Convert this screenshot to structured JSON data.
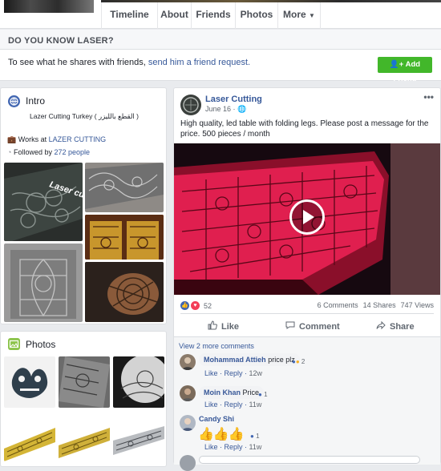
{
  "tabs": [
    "Timeline",
    "About",
    "Friends",
    "Photos",
    "More"
  ],
  "dykl": {
    "heading": "DO YOU KNOW LASER?",
    "text_prefix": "To see what he shares with friends,",
    "link": "send him a friend request.",
    "button": "Add Friend"
  },
  "intro": {
    "title": "Intro",
    "bio": "Lazer Cutting Turkey ( القطع بالليزر )",
    "works_prefix": "Works at",
    "works_at": "LAZER CUTTING",
    "followed_prefix": "Followed by",
    "followed_count": "272 people",
    "thumb_caption": "Laser cu"
  },
  "photos": {
    "title": "Photos"
  },
  "post": {
    "author": "Laser Cutting",
    "date": "June 16",
    "text": "High quality, led table with folding legs. Please post a message for the price. 500 pieces / month",
    "reactions_count": "52",
    "comments_count": "6 Comments",
    "shares_count": "14 Shares",
    "views_count": "747 Views",
    "actions": [
      "Like",
      "Comment",
      "Share"
    ],
    "view_more": "View 2 more comments",
    "comments": [
      {
        "name": "Mohammad Attieh",
        "text": "price plz",
        "reactions": "2",
        "like": "Like",
        "reply": "Reply",
        "time": "12w"
      },
      {
        "name": "Moin Khan",
        "text": "Price",
        "reactions": "1",
        "like": "Like",
        "reply": "Reply",
        "time": "11w"
      },
      {
        "name": "Candy Shi",
        "text": "",
        "reactions": "1",
        "like": "Like",
        "reply": "Reply",
        "time": "11w"
      }
    ]
  },
  "colors": {
    "brand": "#4267b2",
    "add_friend": "#42b72a",
    "link": "#365899",
    "table_glow": "#d81a4a"
  }
}
